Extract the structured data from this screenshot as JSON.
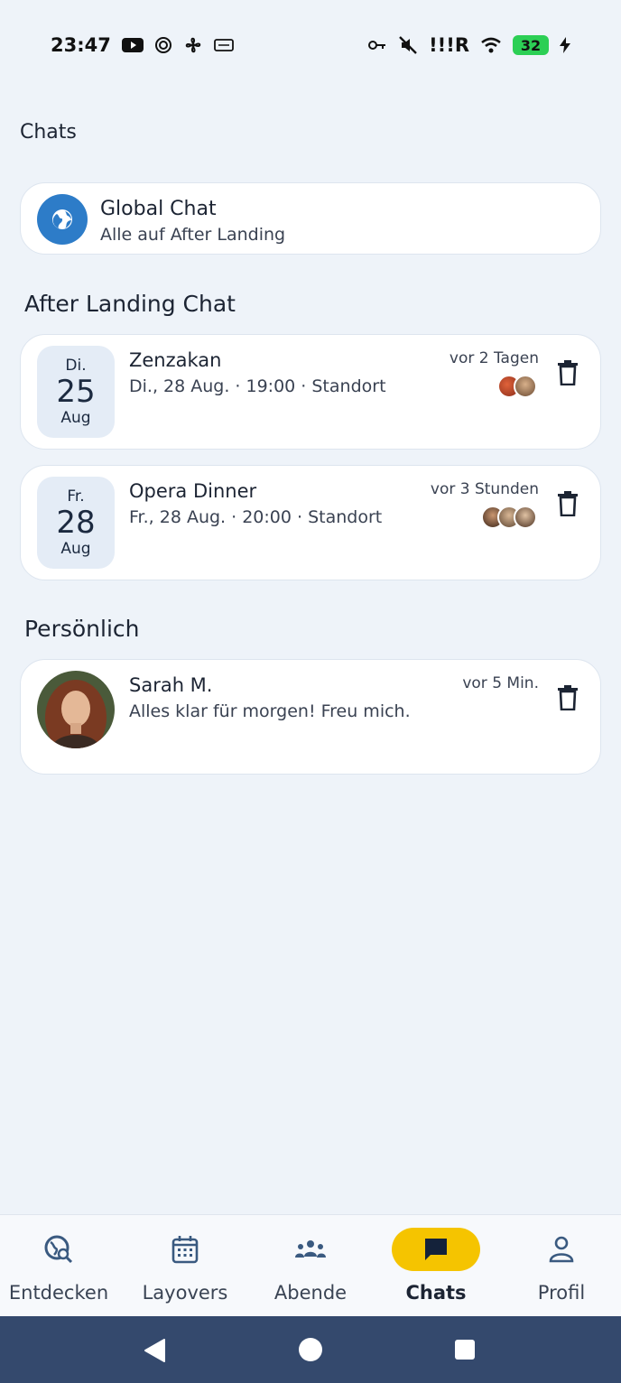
{
  "status_bar": {
    "time": "23:47",
    "battery": "32",
    "network": "!!!R",
    "icons": [
      "youtube-icon",
      "spiral-icon",
      "fan-icon",
      "nfc-icon",
      "key-icon",
      "mute-icon",
      "signal-icon",
      "wifi-icon",
      "battery-icon",
      "charging-icon"
    ]
  },
  "page": {
    "title": "Chats"
  },
  "global_chat": {
    "title": "Global Chat",
    "subtitle": "Alle auf After Landing",
    "icon": "globe-icon"
  },
  "sections": {
    "after_landing": "After Landing Chat",
    "personal": "Persönlich"
  },
  "event_chats": [
    {
      "dow": "Di.",
      "day": "25",
      "month": "Aug",
      "title": "Zenzakan",
      "subtitle": "Di., 28 Aug. · 19:00 · Standort",
      "time": "vor 2 Tagen"
    },
    {
      "dow": "Fr.",
      "day": "28",
      "month": "Aug",
      "title": "Opera Dinner",
      "subtitle": "Fr., 28 Aug. · 20:00 · Standort",
      "time": "vor 3 Stunden"
    }
  ],
  "personal_chats": [
    {
      "name": "Sarah M.",
      "message": "Alles klar für morgen! Freu mich.",
      "time": "vor 5 Min."
    }
  ],
  "bottom_nav": [
    {
      "label": "Entdecken",
      "icon": "globe-search-icon",
      "active": false
    },
    {
      "label": "Layovers",
      "icon": "calendar-icon",
      "active": false
    },
    {
      "label": "Abende",
      "icon": "group-icon",
      "active": false
    },
    {
      "label": "Chats",
      "icon": "chat-bubble-icon",
      "active": true
    },
    {
      "label": "Profil",
      "icon": "person-icon",
      "active": false
    }
  ],
  "colors": {
    "accent": "#f5c400",
    "background": "#eef3f9",
    "system_nav": "#34496d",
    "globe": "#2d7cc8"
  }
}
